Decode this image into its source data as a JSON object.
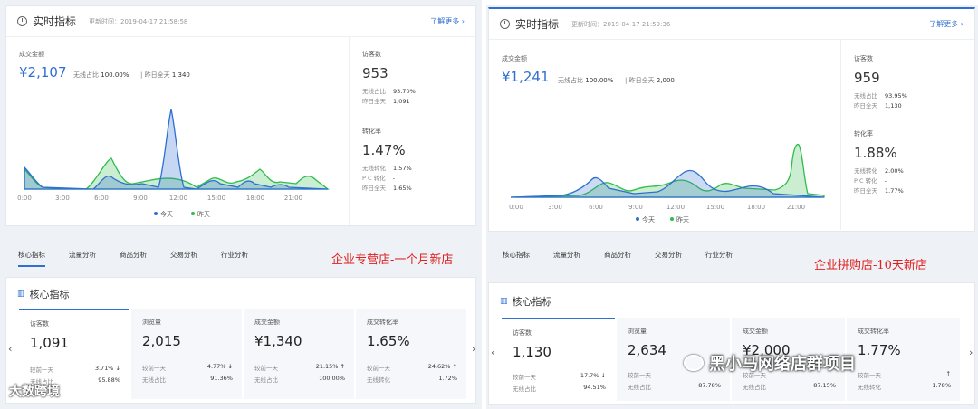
{
  "left": {
    "realtime": {
      "title": "实时指标",
      "update": "更新时间：2019-04-17 21:58:58",
      "more": "了解更多 ›",
      "gmv_label": "成交金额",
      "gmv": "¥2,107",
      "wireless_label": "无线占比",
      "wireless": "100.00%",
      "yday_label": "昨日全天",
      "yday": "1,340",
      "visitors_label": "访客数",
      "visitors": "953",
      "v_w_label": "无线占比",
      "v_w": "93.70%",
      "v_y_label": "昨日全天",
      "v_y": "1,091",
      "conv_label": "转化率",
      "conv": "1.47%",
      "c1_label": "无线转化",
      "c1": "1.57%",
      "c2_label": "P C 转化",
      "c2": "-",
      "c3_label": "昨日全天",
      "c3": "1.65%",
      "xticks": [
        "0:00",
        "3:00",
        "6:00",
        "9:00",
        "12:00",
        "15:00",
        "18:00",
        "21:00"
      ],
      "legend_today": "今天",
      "legend_yday": "昨天"
    },
    "tabs": [
      "核心指标",
      "流量分析",
      "商品分析",
      "交易分析",
      "行业分析"
    ],
    "annotation": "企业专营店-一个月新店",
    "core_title": "核心指标",
    "kpis": [
      {
        "name": "访客数",
        "value": "1,091",
        "c1": "较前一天",
        "c1v": "3.71% ↓",
        "c2": "无线占比",
        "c2v": "95.88%"
      },
      {
        "name": "浏览量",
        "value": "2,015",
        "c1": "较前一天",
        "c1v": "4.77% ↓",
        "c2": "无线占比",
        "c2v": "91.36%"
      },
      {
        "name": "成交金额",
        "value": "¥1,340",
        "c1": "较前一天",
        "c1v": "21.15% ↑",
        "c2": "无线占比",
        "c2v": "100.00%"
      },
      {
        "name": "成交转化率",
        "value": "1.65%",
        "c1": "较前一天",
        "c1v": "24.62% ↑",
        "c2": "无线转化",
        "c2v": "1.72%"
      }
    ],
    "watermark": "大数跨境"
  },
  "right": {
    "realtime": {
      "title": "实时指标",
      "update": "更新时间：2019-04-17 21:59:36",
      "more": "了解更多 ›",
      "gmv_label": "成交金额",
      "gmv": "¥1,241",
      "wireless_label": "无线占比",
      "wireless": "100.00%",
      "yday_label": "昨日全天",
      "yday": "2,000",
      "visitors_label": "访客数",
      "visitors": "959",
      "v_w_label": "无线占比",
      "v_w": "93.95%",
      "v_y_label": "昨日全天",
      "v_y": "1,130",
      "conv_label": "转化率",
      "conv": "1.88%",
      "c1_label": "无线转化",
      "c1": "2.00%",
      "c2_label": "P C 转化",
      "c2": "-",
      "c3_label": "昨日全天",
      "c3": "1.77%",
      "xticks": [
        "0:00",
        "3:00",
        "6:00",
        "9:00",
        "12:00",
        "15:00",
        "18:00",
        "21:00"
      ],
      "legend_today": "今天",
      "legend_yday": "昨天"
    },
    "tabs": [
      "核心指标",
      "流量分析",
      "商品分析",
      "交易分析",
      "行业分析"
    ],
    "annotation": "企业拼购店-10天新店",
    "core_title": "核心指标",
    "kpis": [
      {
        "name": "访客数",
        "value": "1,130",
        "c1": "较前一天",
        "c1v": "17.7% ↓",
        "c2": "无线占比",
        "c2v": "94.51%"
      },
      {
        "name": "浏览量",
        "value": "2,634",
        "c1": "较前一天",
        "c1v": "",
        "c2": "无线占比",
        "c2v": "87.78%"
      },
      {
        "name": "成交金额",
        "value": "¥2,000",
        "c1": "较前一天",
        "c1v": "",
        "c2": "无线占比",
        "c2v": "87.15%"
      },
      {
        "name": "成交转化率",
        "value": "1.77%",
        "c1": "较前一天",
        "c1v": "↑",
        "c2": "无线转化",
        "c2v": "1.78%"
      }
    ],
    "watermark": "黑小马网络店群项目"
  },
  "colors": {
    "today": "#2f6fd1",
    "yday": "#2ebd4a",
    "accent": "#2f6fd1",
    "red": "#e02020"
  }
}
